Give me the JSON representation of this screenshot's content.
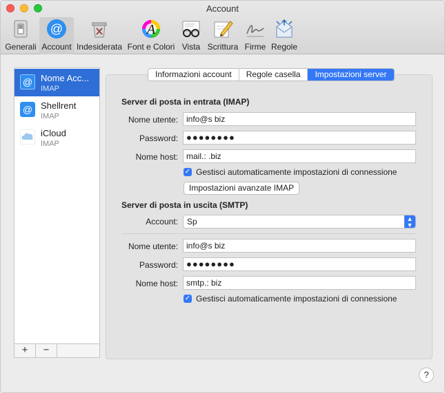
{
  "window": {
    "title": "Account"
  },
  "toolbar": {
    "items": [
      {
        "label": "Generali",
        "icon": "switch-icon"
      },
      {
        "label": "Account",
        "icon": "at-sign-icon"
      },
      {
        "label": "Indesiderata",
        "icon": "trash-icon"
      },
      {
        "label": "Font e Colori",
        "icon": "font-colors-icon"
      },
      {
        "label": "Vista",
        "icon": "glasses-icon"
      },
      {
        "label": "Scrittura",
        "icon": "pencil-icon"
      },
      {
        "label": "Firme",
        "icon": "signature-icon"
      },
      {
        "label": "Regole",
        "icon": "rules-envelope-icon"
      }
    ]
  },
  "sidebar": {
    "accounts": [
      {
        "name": "Nome Acc...",
        "type": "IMAP",
        "icon": "at-sign-icon",
        "selected": true
      },
      {
        "name": "Shellrent",
        "type": "IMAP",
        "icon": "at-sign-icon",
        "selected": false
      },
      {
        "name": "iCloud",
        "type": "IMAP",
        "icon": "cloud-icon",
        "selected": false
      }
    ],
    "add_label": "+",
    "remove_label": "−"
  },
  "tabs": {
    "items": [
      "Informazioni account",
      "Regole casella",
      "Impostazioni server"
    ],
    "active": "Impostazioni server"
  },
  "incoming": {
    "title": "Server di posta in entrata (IMAP)",
    "username_label": "Nome utente:",
    "username_value": "info@s        biz",
    "password_label": "Password:",
    "password_value": "●●●●●●●●",
    "host_label": "Nome host:",
    "host_value": "mail.:         .biz",
    "auto_label": "Gestisci automaticamente impostazioni di connessione",
    "auto_checked": true,
    "advanced_button": "Impostazioni avanzate IMAP"
  },
  "outgoing": {
    "title": "Server di posta in uscita (SMTP)",
    "account_label": "Account:",
    "account_value": "Sp",
    "username_label": "Nome utente:",
    "username_value": "info@s        biz",
    "password_label": "Password:",
    "password_value": "●●●●●●●●",
    "host_label": "Nome host:",
    "host_value": "smtp.:         biz",
    "auto_label": "Gestisci automaticamente impostazioni di connessione",
    "auto_checked": true
  },
  "help_label": "?",
  "colors": {
    "accent": "#3478f6",
    "selection": "#2e6ed6"
  }
}
